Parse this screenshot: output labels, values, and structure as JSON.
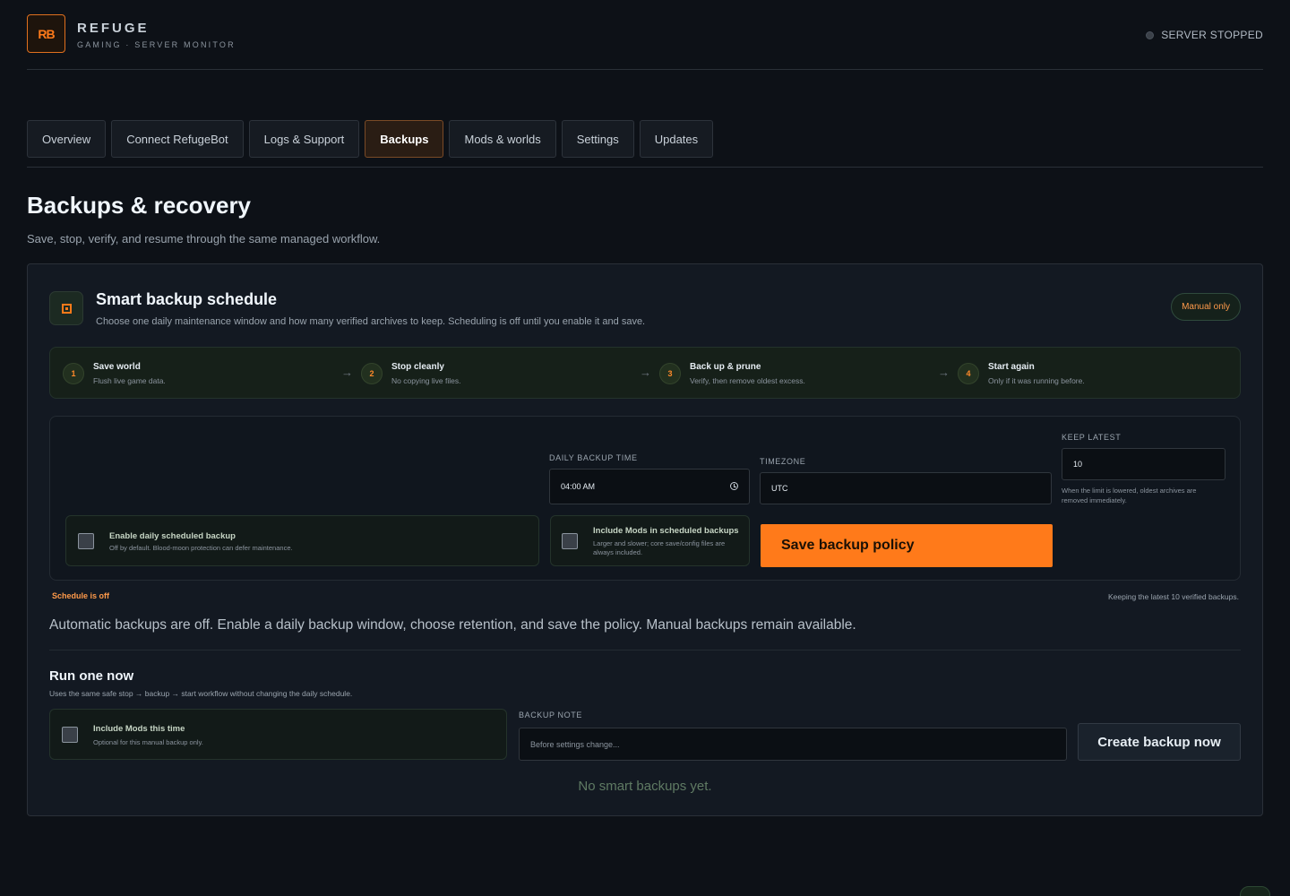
{
  "brand": {
    "logo": "RB",
    "title": "REFUGE",
    "subtitle": "GAMING · SERVER MONITOR"
  },
  "server": {
    "status_text": "SERVER STOPPED",
    "status_color": "#3b4149"
  },
  "tabs": [
    {
      "label": "Overview",
      "active": false
    },
    {
      "label": "Connect RefugeBot",
      "active": false
    },
    {
      "label": "Logs & Support",
      "active": false
    },
    {
      "label": "Backups",
      "active": true
    },
    {
      "label": "Mods & worlds",
      "active": false
    },
    {
      "label": "Settings",
      "active": false
    },
    {
      "label": "Updates",
      "active": false
    }
  ],
  "page": {
    "title": "Backups & recovery",
    "subtitle": "Save, stop, verify, and resume through the same managed workflow."
  },
  "schedule": {
    "icon": "schedule-icon",
    "title": "Smart backup schedule",
    "subtitle": "Choose one daily maintenance window and how many verified archives to keep. Scheduling is off until you enable it and save.",
    "badge": "Manual only",
    "steps": [
      {
        "num": "1",
        "title": "Save world",
        "desc": "Flush live game data."
      },
      {
        "num": "2",
        "title": "Stop cleanly",
        "desc": "No copying live files."
      },
      {
        "num": "3",
        "title": "Back up & prune",
        "desc": "Verify, then remove oldest excess."
      },
      {
        "num": "4",
        "title": "Start again",
        "desc": "Only if it was running before."
      }
    ],
    "step_arrow": "→",
    "time_label": "DAILY BACKUP TIME",
    "time_value": "04:00 AM",
    "timezone_label": "TIMEZONE",
    "timezone_value": "UTC",
    "keep_label": "KEEP LATEST",
    "keep_value": "10",
    "keep_help": "When the limit is lowered, oldest archives are removed immediately.",
    "enable_title": "Enable daily scheduled backup",
    "enable_desc": "Off by default. Blood-moon protection can defer maintenance.",
    "enable_checked": false,
    "mods_title": "Include Mods in scheduled backups",
    "mods_desc": "Larger and slower; core save/config files are always included.",
    "mods_checked": false,
    "save_label": "Save backup policy",
    "accent_color": "#ff7a1a",
    "status_off": "Schedule is off",
    "keep_status": "Keeping the latest 10 verified backups.",
    "auto_message": "Automatic backups are off. Enable a daily backup window, choose retention, and save the policy. Manual backups remain available."
  },
  "run_now": {
    "title": "Run one now",
    "subtitle": "Uses the same safe stop → backup → start workflow without changing the daily schedule.",
    "mods_title": "Include Mods this time",
    "mods_desc": "Optional for this manual backup only.",
    "mods_checked": false,
    "note_label": "BACKUP NOTE",
    "note_value": "",
    "note_placeholder": "Before settings change...",
    "create_label": "Create backup now",
    "empty_message": "No smart backups yet."
  }
}
